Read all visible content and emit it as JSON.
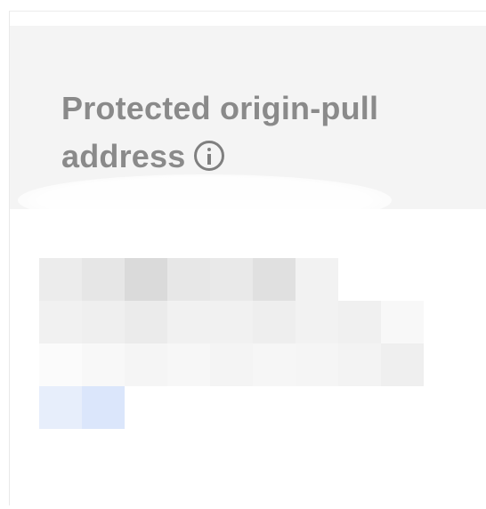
{
  "table": {
    "header": {
      "label": "Protected origin-pull address",
      "icon": "info-icon"
    },
    "rows": [
      {
        "value_state": "redacted"
      }
    ]
  },
  "colors": {
    "header_bg": "#f4f4f4",
    "header_text": "#8a8a8a",
    "link_blue": "#dbe6fb"
  }
}
